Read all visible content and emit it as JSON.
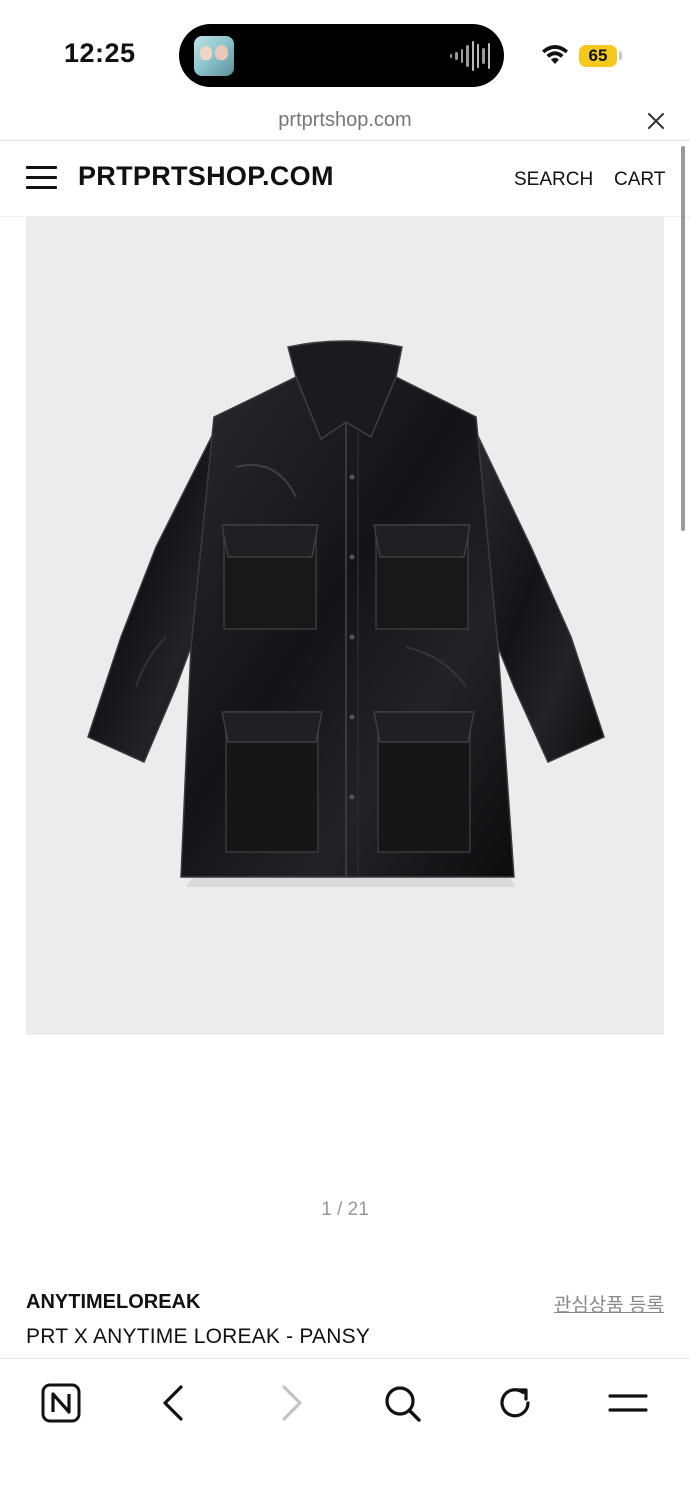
{
  "status_bar": {
    "time": "12:25",
    "battery": "65",
    "icons": [
      "album-art-icon",
      "waveform-icon",
      "wifi-icon",
      "battery-icon"
    ],
    "battery_color": "#f4c91d"
  },
  "browser": {
    "url": "prtprtshop.com",
    "close_icon": "close-icon"
  },
  "header": {
    "logo": "PRTPRTSHOP.COM",
    "search_label": "SEARCH",
    "cart_label": "CART",
    "menu_icon": "hamburger-icon"
  },
  "product": {
    "image_icon": "leather-jacket-image",
    "pager": "1 / 21",
    "brand": "ANYTIMELOREAK",
    "wishlist_label": "관심상품 등록",
    "name": "PRT X ANYTIME LOREAK - PANSY"
  },
  "toolbar": {
    "items": [
      "naver-n-icon",
      "back-icon",
      "forward-icon",
      "search-icon",
      "refresh-icon",
      "menu-icon"
    ]
  },
  "colors": {
    "image_background": "#ececec",
    "text": "#111111",
    "muted": "#999999"
  }
}
